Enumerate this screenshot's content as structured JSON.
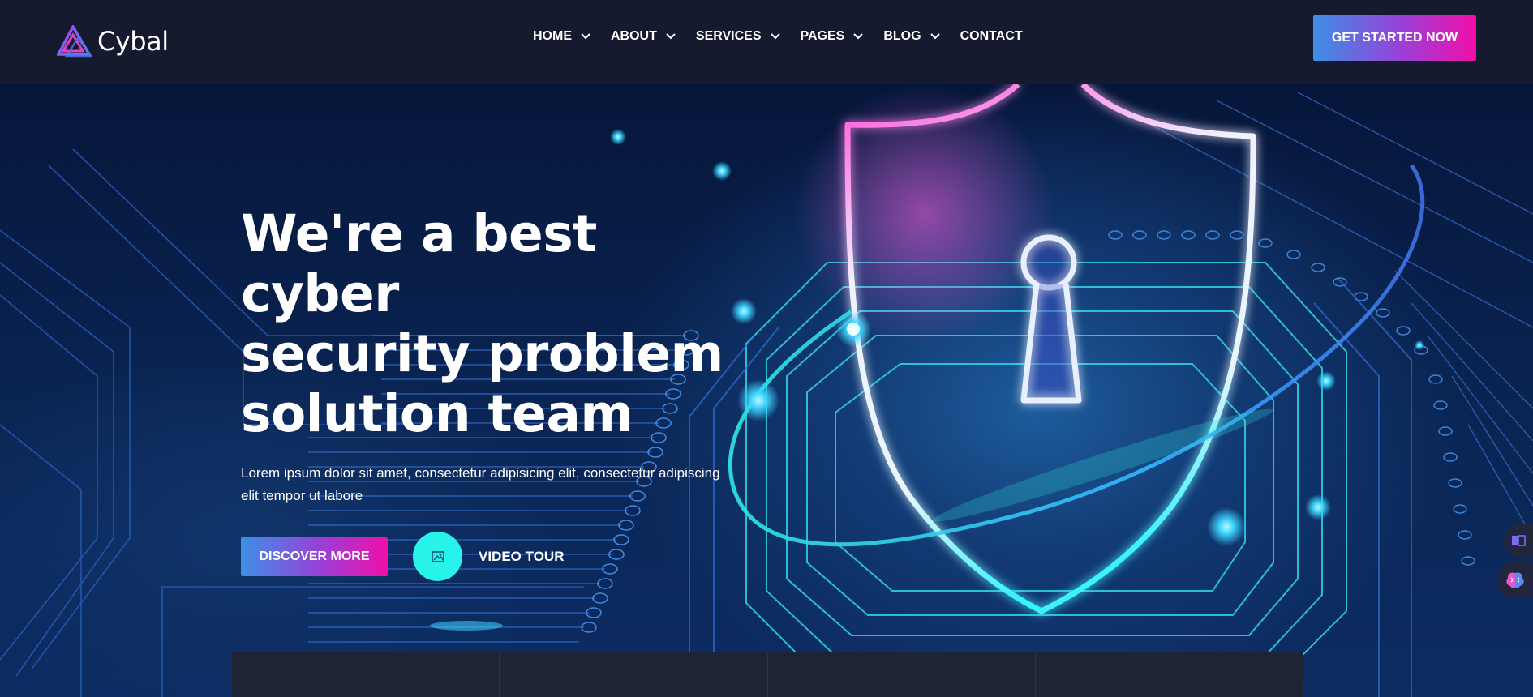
{
  "brand": {
    "name": "Cybal"
  },
  "nav": {
    "items": [
      {
        "label": "HOME",
        "has_dropdown": true
      },
      {
        "label": "ABOUT",
        "has_dropdown": true
      },
      {
        "label": "SERVICES",
        "has_dropdown": true
      },
      {
        "label": "PAGES",
        "has_dropdown": true
      },
      {
        "label": "BLOG",
        "has_dropdown": true
      },
      {
        "label": "CONTACT",
        "has_dropdown": false
      }
    ],
    "cta_label": "GET STARTED NOW"
  },
  "hero": {
    "title_lines": [
      "We're a best cyber",
      "security problem",
      "solution team"
    ],
    "text": "Lorem ipsum dolor sit amet, consectetur adipisicing elit, consectetur adipiscing elit tempor ut labore",
    "discover_label": "DISCOVER MORE",
    "video_label": "VIDEO TOUR"
  },
  "icons": {
    "logo": "triangle-logo-icon",
    "nav_dropdown": "chevron-down-icon",
    "video": "image-icon",
    "side_widget_1": "book-icon",
    "side_widget_2": "brain-icon"
  },
  "colors": {
    "header_bg": "#151a2e",
    "gradient_start": "#3d8fe6",
    "gradient_end": "#f10fa9",
    "accent_cyan": "#27f3ea",
    "shield_pink": "#ff4fd8",
    "shield_cyan": "#3df2ff"
  }
}
